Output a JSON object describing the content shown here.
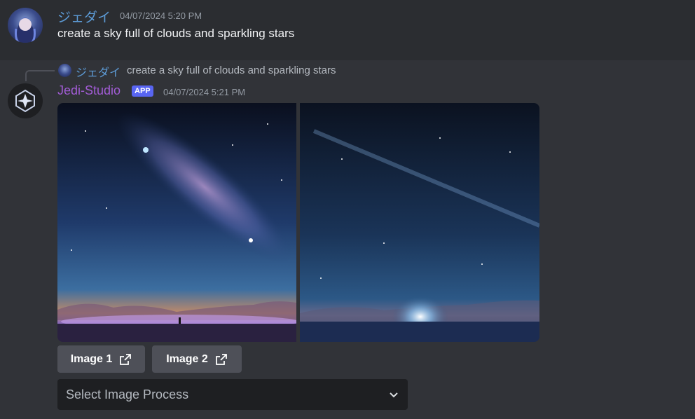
{
  "message1": {
    "username": "ジェダイ",
    "timestamp": "04/07/2024 5:20 PM",
    "content": "create a sky full of clouds and sparkling stars"
  },
  "message2": {
    "reply": {
      "username": "ジェダイ",
      "text": "create a sky full of clouds and sparkling stars"
    },
    "username": "Jedi-Studio",
    "badge": "APP",
    "timestamp": "04/07/2024 5:21 PM",
    "buttons": [
      {
        "label": "Image 1"
      },
      {
        "label": "Image 2"
      }
    ],
    "select": {
      "placeholder": "Select Image Process"
    }
  },
  "colors": {
    "username1": "#5d9bd6",
    "username2": "#a25cd6",
    "badge": "#5865f2"
  }
}
